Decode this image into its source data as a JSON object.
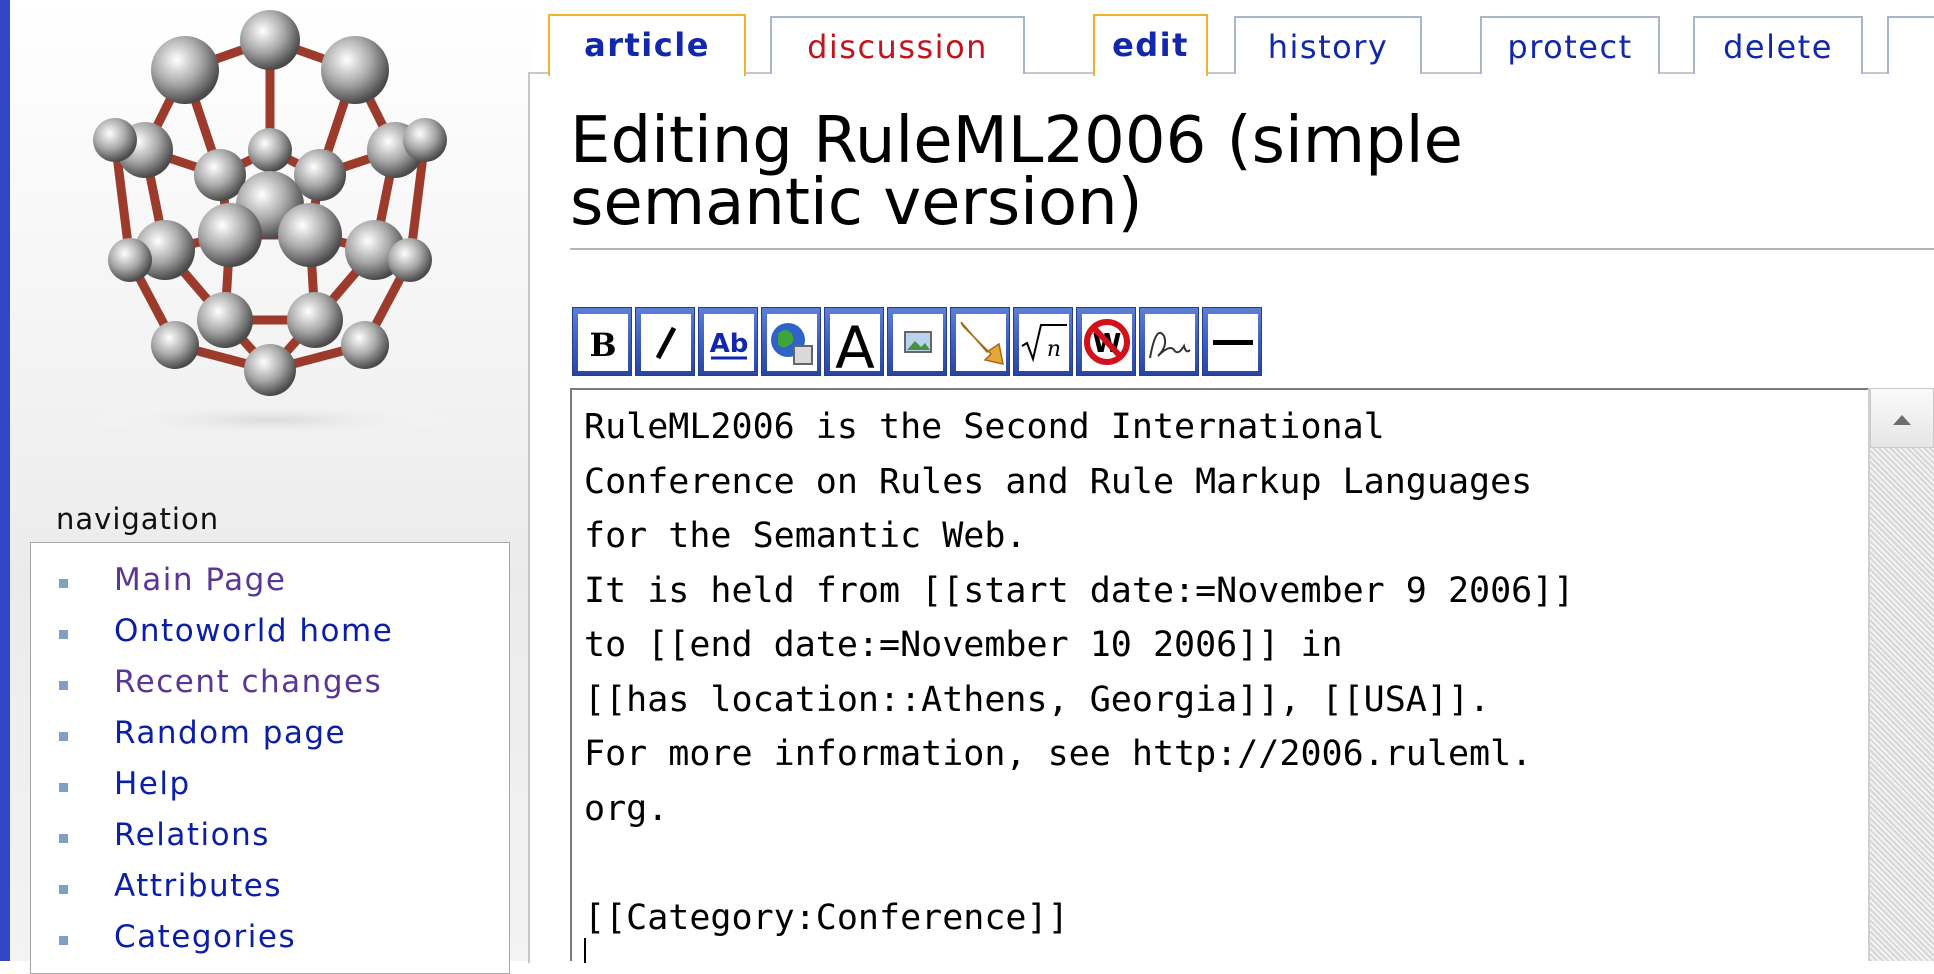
{
  "sidebar": {
    "logo": "buckyball-wiki-logo",
    "navigation_heading": "navigation",
    "items": [
      {
        "label": "Main Page",
        "visited": true
      },
      {
        "label": "Ontoworld home",
        "visited": false
      },
      {
        "label": "Recent changes",
        "visited": true
      },
      {
        "label": "Random page",
        "visited": false
      },
      {
        "label": "Help",
        "visited": false
      },
      {
        "label": "Relations",
        "visited": false
      },
      {
        "label": "Attributes",
        "visited": false
      },
      {
        "label": "Categories",
        "visited": false
      }
    ]
  },
  "tabs": [
    {
      "label": "article",
      "selected": true
    },
    {
      "label": "discussion",
      "selected": false
    },
    {
      "label": "edit",
      "selected": true
    },
    {
      "label": "history",
      "selected": false
    },
    {
      "label": "protect",
      "selected": false
    },
    {
      "label": "delete",
      "selected": false
    }
  ],
  "page": {
    "title": "Editing RuleML2006 (simple semantic version)"
  },
  "toolbar": [
    {
      "name": "bold",
      "glyph": "B"
    },
    {
      "name": "italic",
      "glyph": "I"
    },
    {
      "name": "internal-link",
      "glyph": "Ab"
    },
    {
      "name": "external-link",
      "glyph": "globe"
    },
    {
      "name": "headline",
      "glyph": "A"
    },
    {
      "name": "embedded-image",
      "glyph": "picture"
    },
    {
      "name": "media-file",
      "glyph": "horn"
    },
    {
      "name": "math-formula",
      "glyph": "√n"
    },
    {
      "name": "no-wiki-formatting",
      "glyph": "no-w"
    },
    {
      "name": "signature",
      "glyph": "signature"
    },
    {
      "name": "horizontal-line",
      "glyph": "—"
    }
  ],
  "editor": {
    "lines": [
      "RuleML2006 is the Second International",
      "Conference on Rules and Rule Markup Languages",
      "for the Semantic Web.",
      "It is held from [[start date:=November 9 2006]]",
      "to [[end date:=November 10 2006]] in",
      "[[has location::Athens, Georgia]], [[USA]].",
      "For more information, see http://2006.ruleml.",
      "org.",
      "",
      "[[Category:Conference]]"
    ]
  },
  "colors": {
    "accent_strip": "#2f46c6",
    "tab_selected_border": "#f2b230",
    "link": "#0b1ea8",
    "visited_link": "#5a3696",
    "discussion_link": "#c0151c",
    "toolbar_button": "#3b5cbd"
  }
}
